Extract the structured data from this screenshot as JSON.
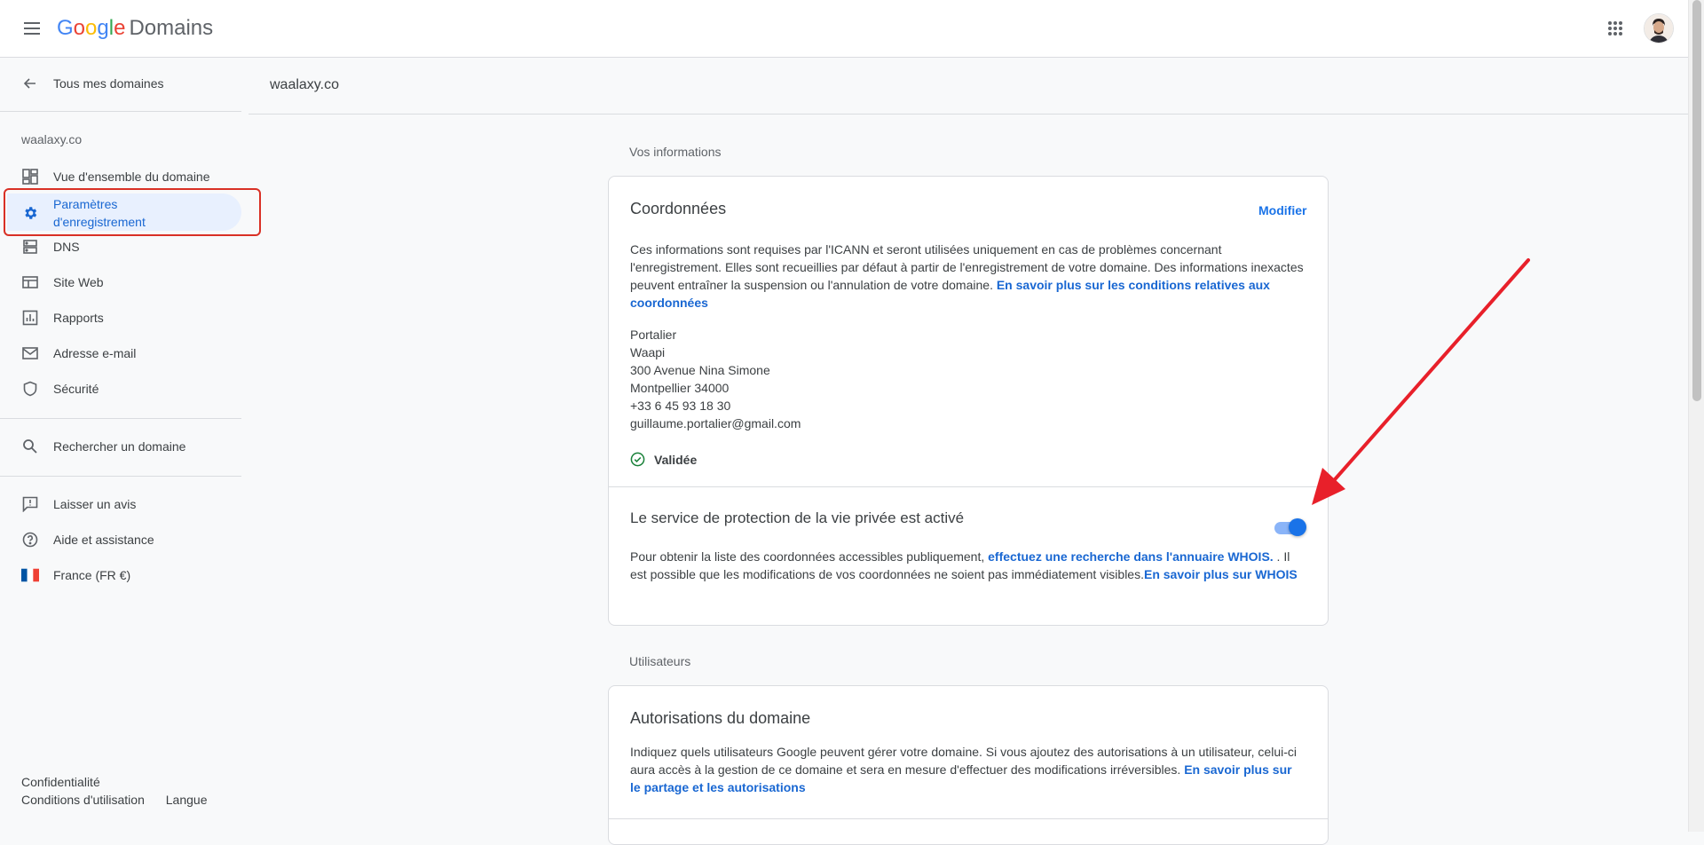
{
  "header": {
    "logo_google": "Google",
    "logo_product": "Domains"
  },
  "sidebar": {
    "back_label": "Tous mes domaines",
    "site_name": "waalaxy.co",
    "items": [
      {
        "label": "Vue d'ensemble du domaine",
        "icon": "dashboard-icon"
      },
      {
        "label": "Paramètres d'enregistrement",
        "icon": "gear-icon",
        "selected": true
      },
      {
        "label": "DNS",
        "icon": "dns-icon"
      },
      {
        "label": "Site Web",
        "icon": "website-icon"
      },
      {
        "label": "Rapports",
        "icon": "bar-chart-icon"
      },
      {
        "label": "Adresse e-mail",
        "icon": "mail-icon"
      },
      {
        "label": "Sécurité",
        "icon": "shield-icon"
      }
    ],
    "search_label": "Rechercher un domaine",
    "feedback_label": "Laisser un avis",
    "help_label": "Aide et assistance",
    "locale_label": "France (FR €)",
    "footer": {
      "privacy": "Confidentialité",
      "terms": "Conditions d'utilisation",
      "language": "Langue"
    }
  },
  "page": {
    "domain_title": "waalaxy.co",
    "section_info": "Vos informations",
    "section_users": "Utilisateurs"
  },
  "contact_card": {
    "title": "Coordonnées",
    "edit_label": "Modifier",
    "description": "Ces informations sont requises par l'ICANN et seront utilisées uniquement en cas de problèmes concernant l'enregistrement. Elles sont recueillies par défaut à partir de l'enregistrement de votre domaine. Des informations inexactes peuvent entraîner la suspension ou l'annulation de votre domaine. ",
    "description_link": "En savoir plus sur les conditions relatives aux coordonnées",
    "address_lines": [
      "Portalier",
      "Waapi",
      "300 Avenue Nina Simone",
      "Montpellier 34000",
      "+33 6 45 93 18 30",
      "guillaume.portalier@gmail.com"
    ],
    "status": "Validée",
    "privacy_title": "Le service de protection de la vie privée est activé",
    "privacy_enabled": true,
    "privacy_text_1": "Pour obtenir la liste des coordonnées accessibles publiquement, ",
    "privacy_link_1": "effectuez une recherche dans l'annuaire WHOIS.",
    "privacy_text_2": " . Il est possible que les modifications de vos coordonnées ne soient pas immédiatement visibles.",
    "privacy_link_2": "En savoir plus sur WHOIS"
  },
  "users_card": {
    "title": "Autorisations du domaine",
    "description": "Indiquez quels utilisateurs Google peuvent gérer votre domaine. Si vous ajoutez des autorisations à un utilisateur, celui-ci aura accès à la gestion de ce domaine et sera en mesure d'effectuer des modifications irréversibles. ",
    "description_link": "En savoir plus sur le partage et les autorisations"
  },
  "colors": {
    "accent": "#1a73e8",
    "selected_bg": "#e8f0fe",
    "annotation_red": "#e8202a",
    "flag_blue": "#0055a4",
    "flag_red": "#ef4135"
  }
}
